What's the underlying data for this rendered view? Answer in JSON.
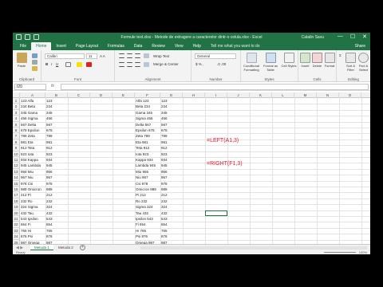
{
  "titlebar": {
    "title": "Formule text.xlsx - Metode de extragere a caracterelor dintr-o celula.xlsx - Excel",
    "user": "Catalin Savu",
    "minimize": "—",
    "maximize": "☐",
    "close": "✕"
  },
  "tabs": [
    "File",
    "Home",
    "Insert",
    "Page Layout",
    "Formulas",
    "Data",
    "Review",
    "View",
    "Help"
  ],
  "tell_me": "Tell me what you want to do",
  "share": "Share",
  "ribbon": {
    "paste": "Paste",
    "font_name": "Calibri",
    "font_size": "11",
    "wrap_text": "Wrap Text",
    "merge_center": "Merge & Center",
    "number_format": "General",
    "conditional_formatting": "Conditional Formatting",
    "format_as_table": "Format as Table",
    "cell_styles": "Cell Styles",
    "insert": "Insert",
    "delete": "Delete",
    "format": "Format",
    "sort_filter": "Sort & Filter",
    "find_select": "Find & Select",
    "groups": [
      "Clipboard",
      "Font",
      "Alignment",
      "Number",
      "Styles",
      "Cells",
      "Editing"
    ]
  },
  "formula_bar": {
    "name_box": "I20",
    "fx": "fx",
    "content": ""
  },
  "columns": [
    "A",
    "B",
    "C",
    "D",
    "E",
    "F",
    "G",
    "H",
    "I",
    "J",
    "K",
    "L",
    "M",
    "N",
    "O",
    "P"
  ],
  "rows": [
    "1",
    "2",
    "3",
    "4",
    "5",
    "6",
    "7",
    "8",
    "9",
    "10",
    "11",
    "12",
    "13",
    "14",
    "15",
    "16",
    "17",
    "18",
    "19",
    "20",
    "21",
    "22",
    "23",
    "24",
    "25"
  ],
  "col_a": [
    "123 Alfa",
    "234 Beta",
    "345 Gama",
    "456 Sigma",
    "567 Delta",
    "678 Epsilon",
    "789 Zeta",
    "981 Eta",
    "912 Teta",
    "923 Iota",
    "934 Kappa",
    "945 Lambda",
    "956 Miu",
    "967 Niu",
    "978 Csi",
    "989 Omicron",
    "212 Pi",
    "232 Ro",
    "324 Sigma",
    "432 Tau",
    "543 Ipsilon",
    "654 Fi",
    "765 Hi",
    "876 Psi",
    "987 Omega"
  ],
  "col_b": [
    "123",
    "234",
    "345",
    "456",
    "567",
    "678",
    "789",
    "981",
    "912",
    "923",
    "934",
    "945",
    "956",
    "967",
    "978",
    "989",
    "212",
    "232",
    "324",
    "432",
    "543",
    "654",
    "765",
    "876",
    "987"
  ],
  "col_f": [
    "Alfa 123",
    "Beta 234",
    "Gama 345",
    "Sigma 456",
    "Delta 567",
    "Epsilon 678",
    "Zeta 789",
    "Eta 981",
    "Teta 912",
    "Iota 923",
    "Kappa 934",
    "Lambda 945",
    "Miu 956",
    "Niu 967",
    "Csi 978",
    "Omicron 989",
    "Pi 212",
    "Ro 232",
    "Sigma 324",
    "Tau 432",
    "Ipsilon 543",
    "Fi 654",
    "Hi 765",
    "Psi 876",
    "Omega 987"
  ],
  "col_g": [
    "123",
    "234",
    "345",
    "456",
    "567",
    "678",
    "789",
    "981",
    "912",
    "923",
    "934",
    "945",
    "956",
    "967",
    "978",
    "989",
    "212",
    "232",
    "324",
    "432",
    "543",
    "654",
    "765",
    "876",
    "987"
  ],
  "formulas": {
    "left": "=LEFT(A1,3)",
    "right": "=RIGHT(F1,3)"
  },
  "sheets": [
    "Metoda 1",
    "Metoda 2"
  ],
  "add_sheet": "+",
  "status": {
    "ready": "Ready",
    "zoom": "100%"
  },
  "colors": {
    "excel_green": "#217346",
    "formula_red": "#e8192c"
  }
}
